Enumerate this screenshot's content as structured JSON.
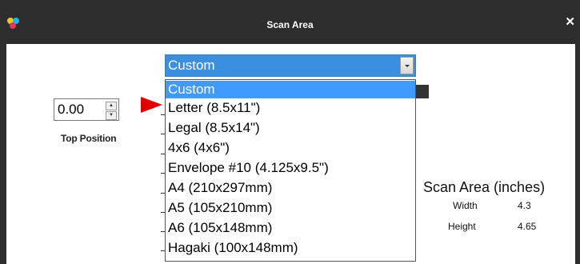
{
  "window": {
    "title": "Scan Area",
    "close_icon": "✕"
  },
  "logo": {
    "icon": "color-dots-logo",
    "colors": [
      "#f5c518",
      "#19b6e6",
      "#e8345b"
    ]
  },
  "top_position": {
    "value": "0.00",
    "label": "Top Position"
  },
  "paper_size": {
    "selected": "Custom",
    "options": [
      "Custom",
      "Letter (8.5x11\")",
      "Legal (8.5x14\")",
      "4x6 (4x6\")",
      "Envelope #10 (4.125x9.5\")",
      "A4 (210x297mm)",
      "A5 (105x210mm)",
      "A6 (105x148mm)",
      "Hagaki (100x148mm)"
    ]
  },
  "scan_area": {
    "title": "Scan Area (inches)",
    "width_label": "Width",
    "width_value": "4.3",
    "height_label": "Height",
    "height_value": "4.65"
  },
  "colors": {
    "accent": "#3f9bff",
    "marker": "#e00000",
    "frame": "#2d2d2d"
  }
}
